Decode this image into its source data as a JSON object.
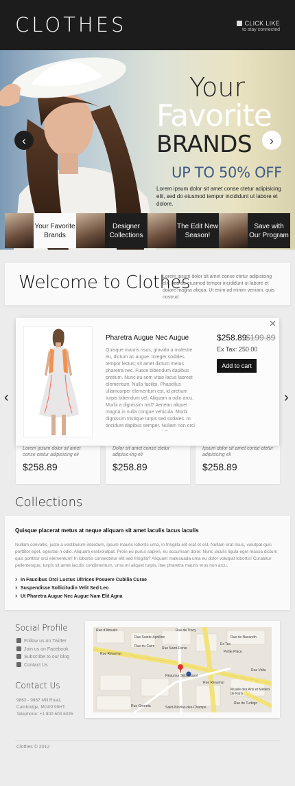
{
  "header": {
    "logo": "CLOTHES",
    "like_label": "CLICK LIKE",
    "like_sub": "to stay connected"
  },
  "hero": {
    "line1": "Your",
    "line2": "Favorite",
    "line3": "BRANDS",
    "offer": "UP TO 50% OFF",
    "description": "Lorem ipsum dolor sit amet conse ctetur adipisicing elit, sed do eiusmod tempor incididunt ut labore et dolore."
  },
  "tabs": [
    {
      "label": "Your Favorite Brands"
    },
    {
      "label": "Designer Collections"
    },
    {
      "label": "The Edit New Season!"
    },
    {
      "label": "Save with Our Program"
    }
  ],
  "welcome": {
    "title": "Welcome to Clothes",
    "text": "Lorem ipsum dolor sit amet conse ctetur adipisicing elit, sed do eiusmod tempor incididunt ut labore et dolore magna aliqua. Ut enim ad minim veniam, quis nostrud"
  },
  "product_popup": {
    "title": "Pharetra Augue Nec Augue",
    "description": "Quisque mauris risus, gravida a molestie eu, dictum ac augue. Integer sodales tempor lectus; sit amet dictum metus pharetra nec. Fusce bibendum dapibus pretium. Nunc eu sem vitae lacus laoreet elementum. Nulla facilisi. Phasellus ullamcorper elementum est, id pretium turpis bibendum vel. Aliquam a odio arcu. Morbi a dignissim nisl? Aenean aliquet magna in nulla congue vehicula. Morbi dignissim tristique turpis sed sodales. In tincidunt dapibus semper. Nullam non orci eu massa tempus aliquam! Quisque placerat metus at neque aliquam sit amet iaculis lacus",
    "price": "$258.89",
    "old_price": "$199.89",
    "tax": "Ex Tax: 250.00",
    "add_to_cart": "Add to cart"
  },
  "product_cards": [
    {
      "desc": "Lorem ipsum dolor sit amet conse ctetur adipisicing eli",
      "price": "$258.89"
    },
    {
      "desc": "Dolor sit amet conse ctetur adipisic-ing eli",
      "price": "$258.89"
    },
    {
      "desc": "Ipsum dolor sit amet conse ctetur adipisicing eli",
      "price": "$258.89"
    }
  ],
  "collections": {
    "title": "Collections",
    "heading": "Quisque placerat metus at neque aliquam sit amet iaculis lacus iaculis",
    "text": "Nullam convallis, justo a vestibulum interdum, ipsum mauris lobortis urna, in fringilla elit erat et est. Nullam erat risus, volutpat quis porttitor eget, egestas n odio. Aliquam eratvolutpat. Proin eu purus sapien, eu accumsan dolor. Nunc iaculis ligula eget massa dictum quis porttitor orci elementum! In lobortis consectetur elit sed fringilla? Aliquam malesuada uma eu dolor volutpat lobortis! Curabitur pellentesque, turpis sit amet iaculis condimentum, urna mi aliquet turpis, itae pharetra mauris eros non arcu.",
    "items": [
      "In Faucibus Orci Luctus Ultrices Posuere Cubilia Curae",
      "Suspendisse Sollicitudin Velit Sed Leo",
      "Ut Pharetra Augue Nec Augue Nam Elit Agna"
    ]
  },
  "social": {
    "title": "Social Profile",
    "items": [
      {
        "label": "Follow us on Twitter",
        "icon": "twitter-icon"
      },
      {
        "label": "Join us on Facebook",
        "icon": "facebook-icon"
      },
      {
        "label": "Subscribe to our blog",
        "icon": "rss-icon"
      },
      {
        "label": "Contact Us",
        "icon": "mail-icon"
      }
    ]
  },
  "contact": {
    "title": "Contact Us",
    "address1": "9863 - 9867 Mill Road,",
    "address2": "Cambridge, MG09 99HT.",
    "phone": "Telephone:  +1 800 603 6035"
  },
  "map": {
    "labels": [
      "Rue d'Aboukir",
      "Rue de Tracy",
      "Rue Sainte-Apolline",
      "Rue de Nazareth",
      "Rue du Caire",
      "Ex Tax",
      "Petite Place",
      "Rue Réaumur",
      "Rue Saint-Denis",
      "Réaumur Sébastopol",
      "Rue Réaumur",
      "Musée des Arts et Métiers de Paris",
      "Rue de Turbigo",
      "Rue Greneta",
      "Saint-Nicolas-des-Champs",
      "Rue Volta"
    ]
  },
  "footer": {
    "copyright": "Clothes © 2012"
  },
  "colors": {
    "header_bg": "#1c1c1c",
    "accent_blue": "#3e5a86",
    "button_bg": "#151515"
  }
}
